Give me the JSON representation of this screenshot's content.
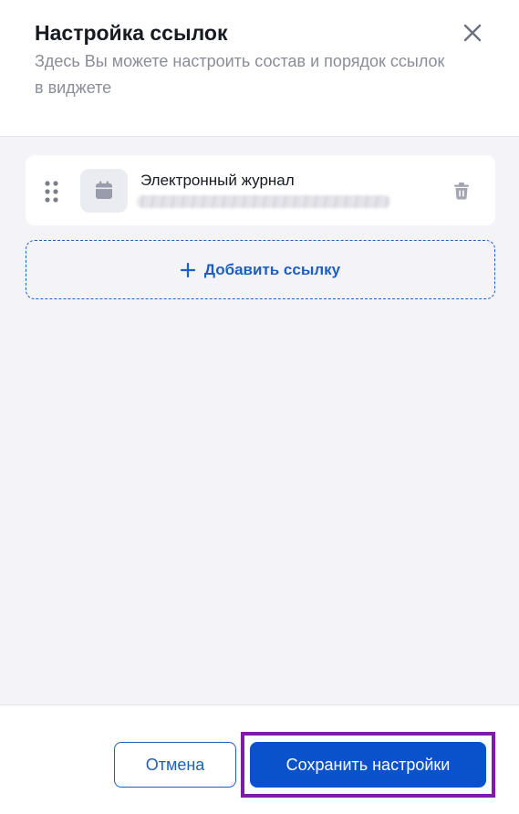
{
  "header": {
    "title": "Настройка ссылок",
    "subtitle": "Здесь Вы можете настроить состав и порядок ссылок в виджете",
    "close_icon": "close-icon"
  },
  "links": [
    {
      "name": "Электронный журнал",
      "icon": "calendar-icon",
      "drag_icon": "drag-handle-icon",
      "delete_icon": "trash-icon"
    }
  ],
  "add_link": {
    "label": "Добавить ссылку",
    "icon": "plus-icon"
  },
  "footer": {
    "cancel_label": "Отмена",
    "save_label": "Сохранить настройки"
  },
  "colors": {
    "accent": "#0a52cc",
    "link_blue": "#1f5fbf",
    "body_bg": "#f3f3f8",
    "highlight": "#7d1ca8"
  }
}
